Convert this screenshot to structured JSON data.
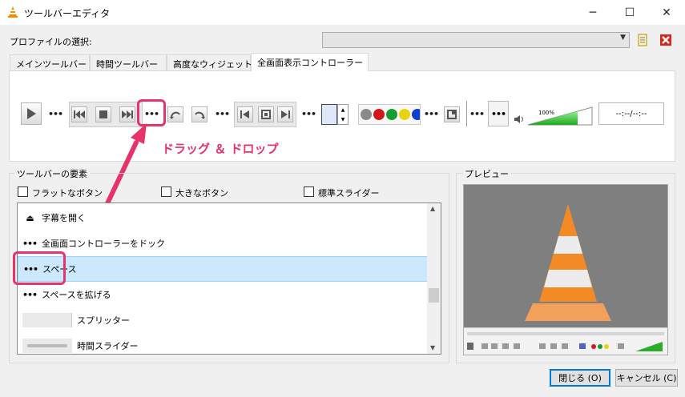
{
  "window": {
    "title": "ツールバーエディタ",
    "controls": [
      "─",
      "☐",
      "✕"
    ]
  },
  "profile": {
    "label": "プロファイルの選択:",
    "value": ""
  },
  "tabs": [
    {
      "label": "メインツールバー"
    },
    {
      "label": "時間ツールバー"
    },
    {
      "label": "高度なウィジェット"
    },
    {
      "label": "全画面表示コントローラー"
    }
  ],
  "toolbar_preview": {
    "volume_label": "100%",
    "time_text": "--:--/--:--"
  },
  "annotation": {
    "text": "ドラッグ ＆ ドロップ",
    "color": "#e8336a"
  },
  "elements_group": {
    "title": "ツールバーの要素",
    "options": [
      {
        "label": "フラットなボタン",
        "checked": false
      },
      {
        "label": "大きなボタン",
        "checked": false
      },
      {
        "label": "標準スライダー",
        "checked": false
      }
    ],
    "items": [
      {
        "label": "字幕を開く",
        "icon": "eject-icon",
        "glyph": "⏏"
      },
      {
        "label": "全画面コントローラーをドック",
        "icon": "spacer-icon",
        "glyph": "•••"
      },
      {
        "label": "スペース",
        "icon": "spacer-icon",
        "glyph": "•••",
        "selected": true
      },
      {
        "label": "スペースを拡げる",
        "icon": "expand-spacer-icon",
        "glyph": "•••"
      },
      {
        "label": "スプリッター",
        "icon": "splitter-icon",
        "glyph": ""
      },
      {
        "label": "時間スライダー",
        "icon": "time-slider-icon",
        "glyph": ""
      }
    ]
  },
  "preview": {
    "title": "プレビュー"
  },
  "buttons": {
    "close": "閉じる (O)",
    "cancel": "キャンセル (C)"
  }
}
